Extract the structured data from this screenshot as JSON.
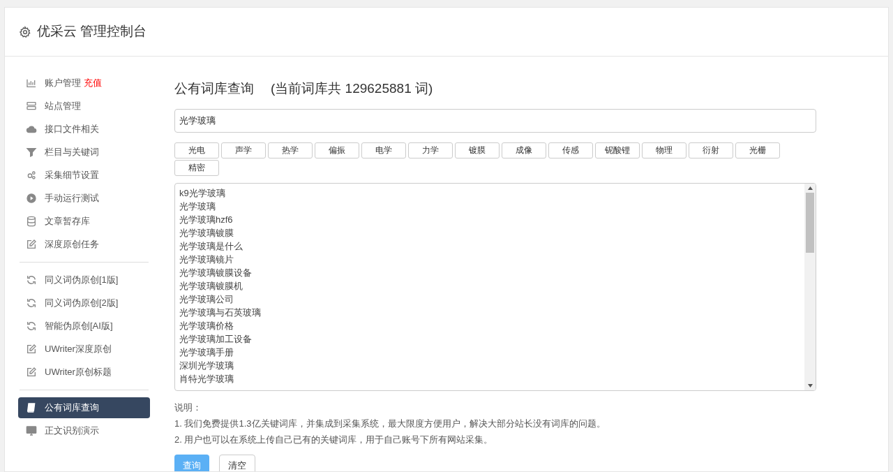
{
  "header": {
    "title": "优采云 管理控制台"
  },
  "sidebar": {
    "groups": [
      [
        {
          "kind": "chart",
          "label": "账户管理",
          "badge": "充值",
          "selected": false
        },
        {
          "kind": "server",
          "label": "站点管理",
          "selected": false
        },
        {
          "kind": "cloud",
          "label": "接口文件相关",
          "selected": false
        },
        {
          "kind": "filter",
          "label": "栏目与关键词",
          "selected": false
        },
        {
          "kind": "gears",
          "label": "采集细节设置",
          "selected": false
        },
        {
          "kind": "play",
          "label": "手动运行测试",
          "selected": false
        },
        {
          "kind": "database",
          "label": "文章暂存库",
          "selected": false
        },
        {
          "kind": "edit",
          "label": "深度原创任务",
          "selected": false
        }
      ],
      [
        {
          "kind": "refresh",
          "label": "同义词伪原创[1版]",
          "selected": false
        },
        {
          "kind": "refresh",
          "label": "同义词伪原创[2版]",
          "selected": false
        },
        {
          "kind": "refresh",
          "label": "智能伪原创[AI版]",
          "selected": false
        },
        {
          "kind": "edit",
          "label": "UWriter深度原创",
          "selected": false
        },
        {
          "kind": "edit",
          "label": "UWriter原创标题",
          "selected": false
        }
      ],
      [
        {
          "kind": "book",
          "label": "公有词库查询",
          "selected": true
        },
        {
          "kind": "monitor",
          "label": "正文识别演示",
          "selected": false
        }
      ]
    ]
  },
  "main": {
    "title": "公有词库查询",
    "subtitle": "(当前词库共 129625881 词)",
    "search": {
      "value": "光学玻璃"
    },
    "tags": [
      "光电",
      "声学",
      "热学",
      "偏振",
      "电学",
      "力学",
      "镀膜",
      "成像",
      "传感",
      "铌酸锂",
      "物理",
      "衍射",
      "光栅",
      "精密"
    ],
    "results": [
      "k9光学玻璃",
      "光学玻璃",
      "光学玻璃hzf6",
      "光学玻璃镀膜",
      "光学玻璃是什么",
      "光学玻璃镜片",
      "光学玻璃镀膜设备",
      "光学玻璃镀膜机",
      "光学玻璃公司",
      "光学玻璃与石英玻璃",
      "光学玻璃价格",
      "光学玻璃加工设备",
      "光学玻璃手册",
      "深圳光学玻璃",
      "肖特光学玻璃"
    ],
    "notes_title": "说明：",
    "notes": [
      "1. 我们免费提供1.3亿关键词库，并集成到采集系统，最大限度方便用户，解决大部分站长没有词库的问题。",
      "2. 用户也可以在系统上传自己已有的关键词库，用于自己账号下所有网站采集。"
    ],
    "buttons": [
      {
        "label": "查询",
        "kind": "primary"
      },
      {
        "label": "清空",
        "kind": "default"
      }
    ]
  }
}
